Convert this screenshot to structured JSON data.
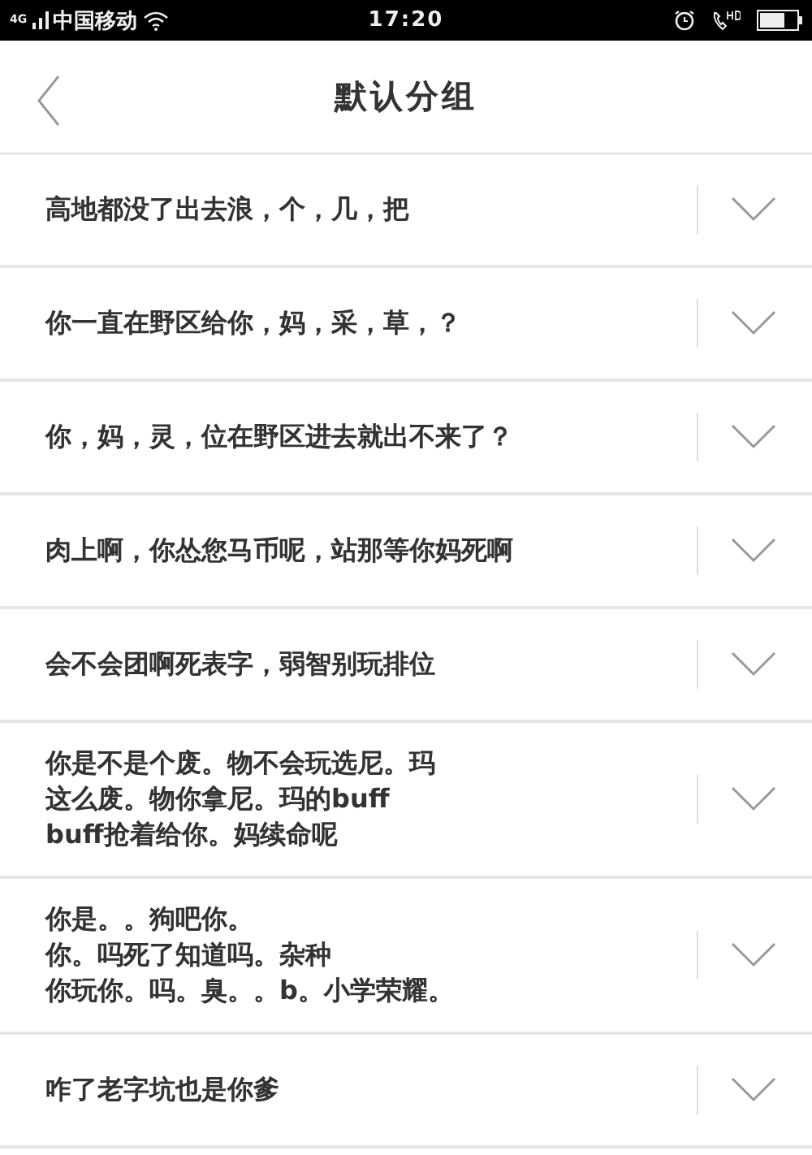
{
  "status_bar": {
    "network": "4G",
    "carrier": "中国移动",
    "time": "17:20"
  },
  "nav": {
    "title": "默认分组"
  },
  "rows": [
    {
      "text": "高地都没了出去浪，个，几，把",
      "expanded": false
    },
    {
      "text": "你一直在野区给你，妈，采，草，？",
      "expanded": false
    },
    {
      "text": "你，妈，灵，位在野区进去就出不来了？",
      "expanded": false
    },
    {
      "text": "肉上啊，你怂您马币呢，站那等你妈死啊",
      "expanded": false
    },
    {
      "text": "会不会团啊死表字，弱智别玩排位",
      "expanded": false
    },
    {
      "lines": [
        "你是不是个废。物不会玩选尼。玛",
        "这么废。物你拿尼。玛的buff",
        "buff抢着给你。妈续命呢"
      ],
      "expanded": false
    },
    {
      "lines": [
        "你是。。狗吧你。",
        "你。吗死了知道吗。杂种",
        "你玩你。吗。臭。。b。小学荣耀。"
      ],
      "expanded": false
    },
    {
      "text": "咋了老字坑也是你爹",
      "expanded": false
    }
  ]
}
